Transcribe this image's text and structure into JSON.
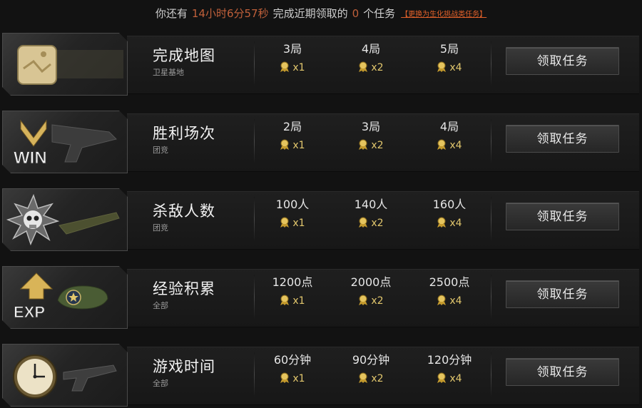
{
  "header": {
    "prefix": "你还有",
    "time_left": "14小时6分57秒",
    "middle": "完成近期领取的",
    "count": "0",
    "suffix": "个任务",
    "switch_link": "【更换为生化挑战类任务】"
  },
  "colors": {
    "highlight": "#c0603a",
    "link": "#e0602a",
    "medal": "#e2c76d"
  },
  "missions": [
    {
      "title": "完成地图",
      "subtitle": "卫星基地",
      "icon": "map-icon",
      "tiers": [
        {
          "req": "3局",
          "reward": "x1"
        },
        {
          "req": "4局",
          "reward": "x2"
        },
        {
          "req": "5局",
          "reward": "x4"
        }
      ],
      "button": "领取任务"
    },
    {
      "title": "胜利场次",
      "subtitle": "团竞",
      "icon": "win-icon",
      "icon_text": "WIN",
      "tiers": [
        {
          "req": "2局",
          "reward": "x1"
        },
        {
          "req": "3局",
          "reward": "x2"
        },
        {
          "req": "4局",
          "reward": "x4"
        }
      ],
      "button": "领取任务"
    },
    {
      "title": "杀敌人数",
      "subtitle": "团竞",
      "icon": "skull-icon",
      "tiers": [
        {
          "req": "100人",
          "reward": "x1"
        },
        {
          "req": "140人",
          "reward": "x2"
        },
        {
          "req": "160人",
          "reward": "x4"
        }
      ],
      "button": "领取任务"
    },
    {
      "title": "经验积累",
      "subtitle": "全部",
      "icon": "exp-icon",
      "icon_text": "EXP",
      "tiers": [
        {
          "req": "1200点",
          "reward": "x1"
        },
        {
          "req": "2000点",
          "reward": "x2"
        },
        {
          "req": "2500点",
          "reward": "x4"
        }
      ],
      "button": "领取任务"
    },
    {
      "title": "游戏时间",
      "subtitle": "全部",
      "icon": "clock-icon",
      "tiers": [
        {
          "req": "60分钟",
          "reward": "x1"
        },
        {
          "req": "90分钟",
          "reward": "x2"
        },
        {
          "req": "120分钟",
          "reward": "x4"
        }
      ],
      "button": "领取任务"
    }
  ]
}
